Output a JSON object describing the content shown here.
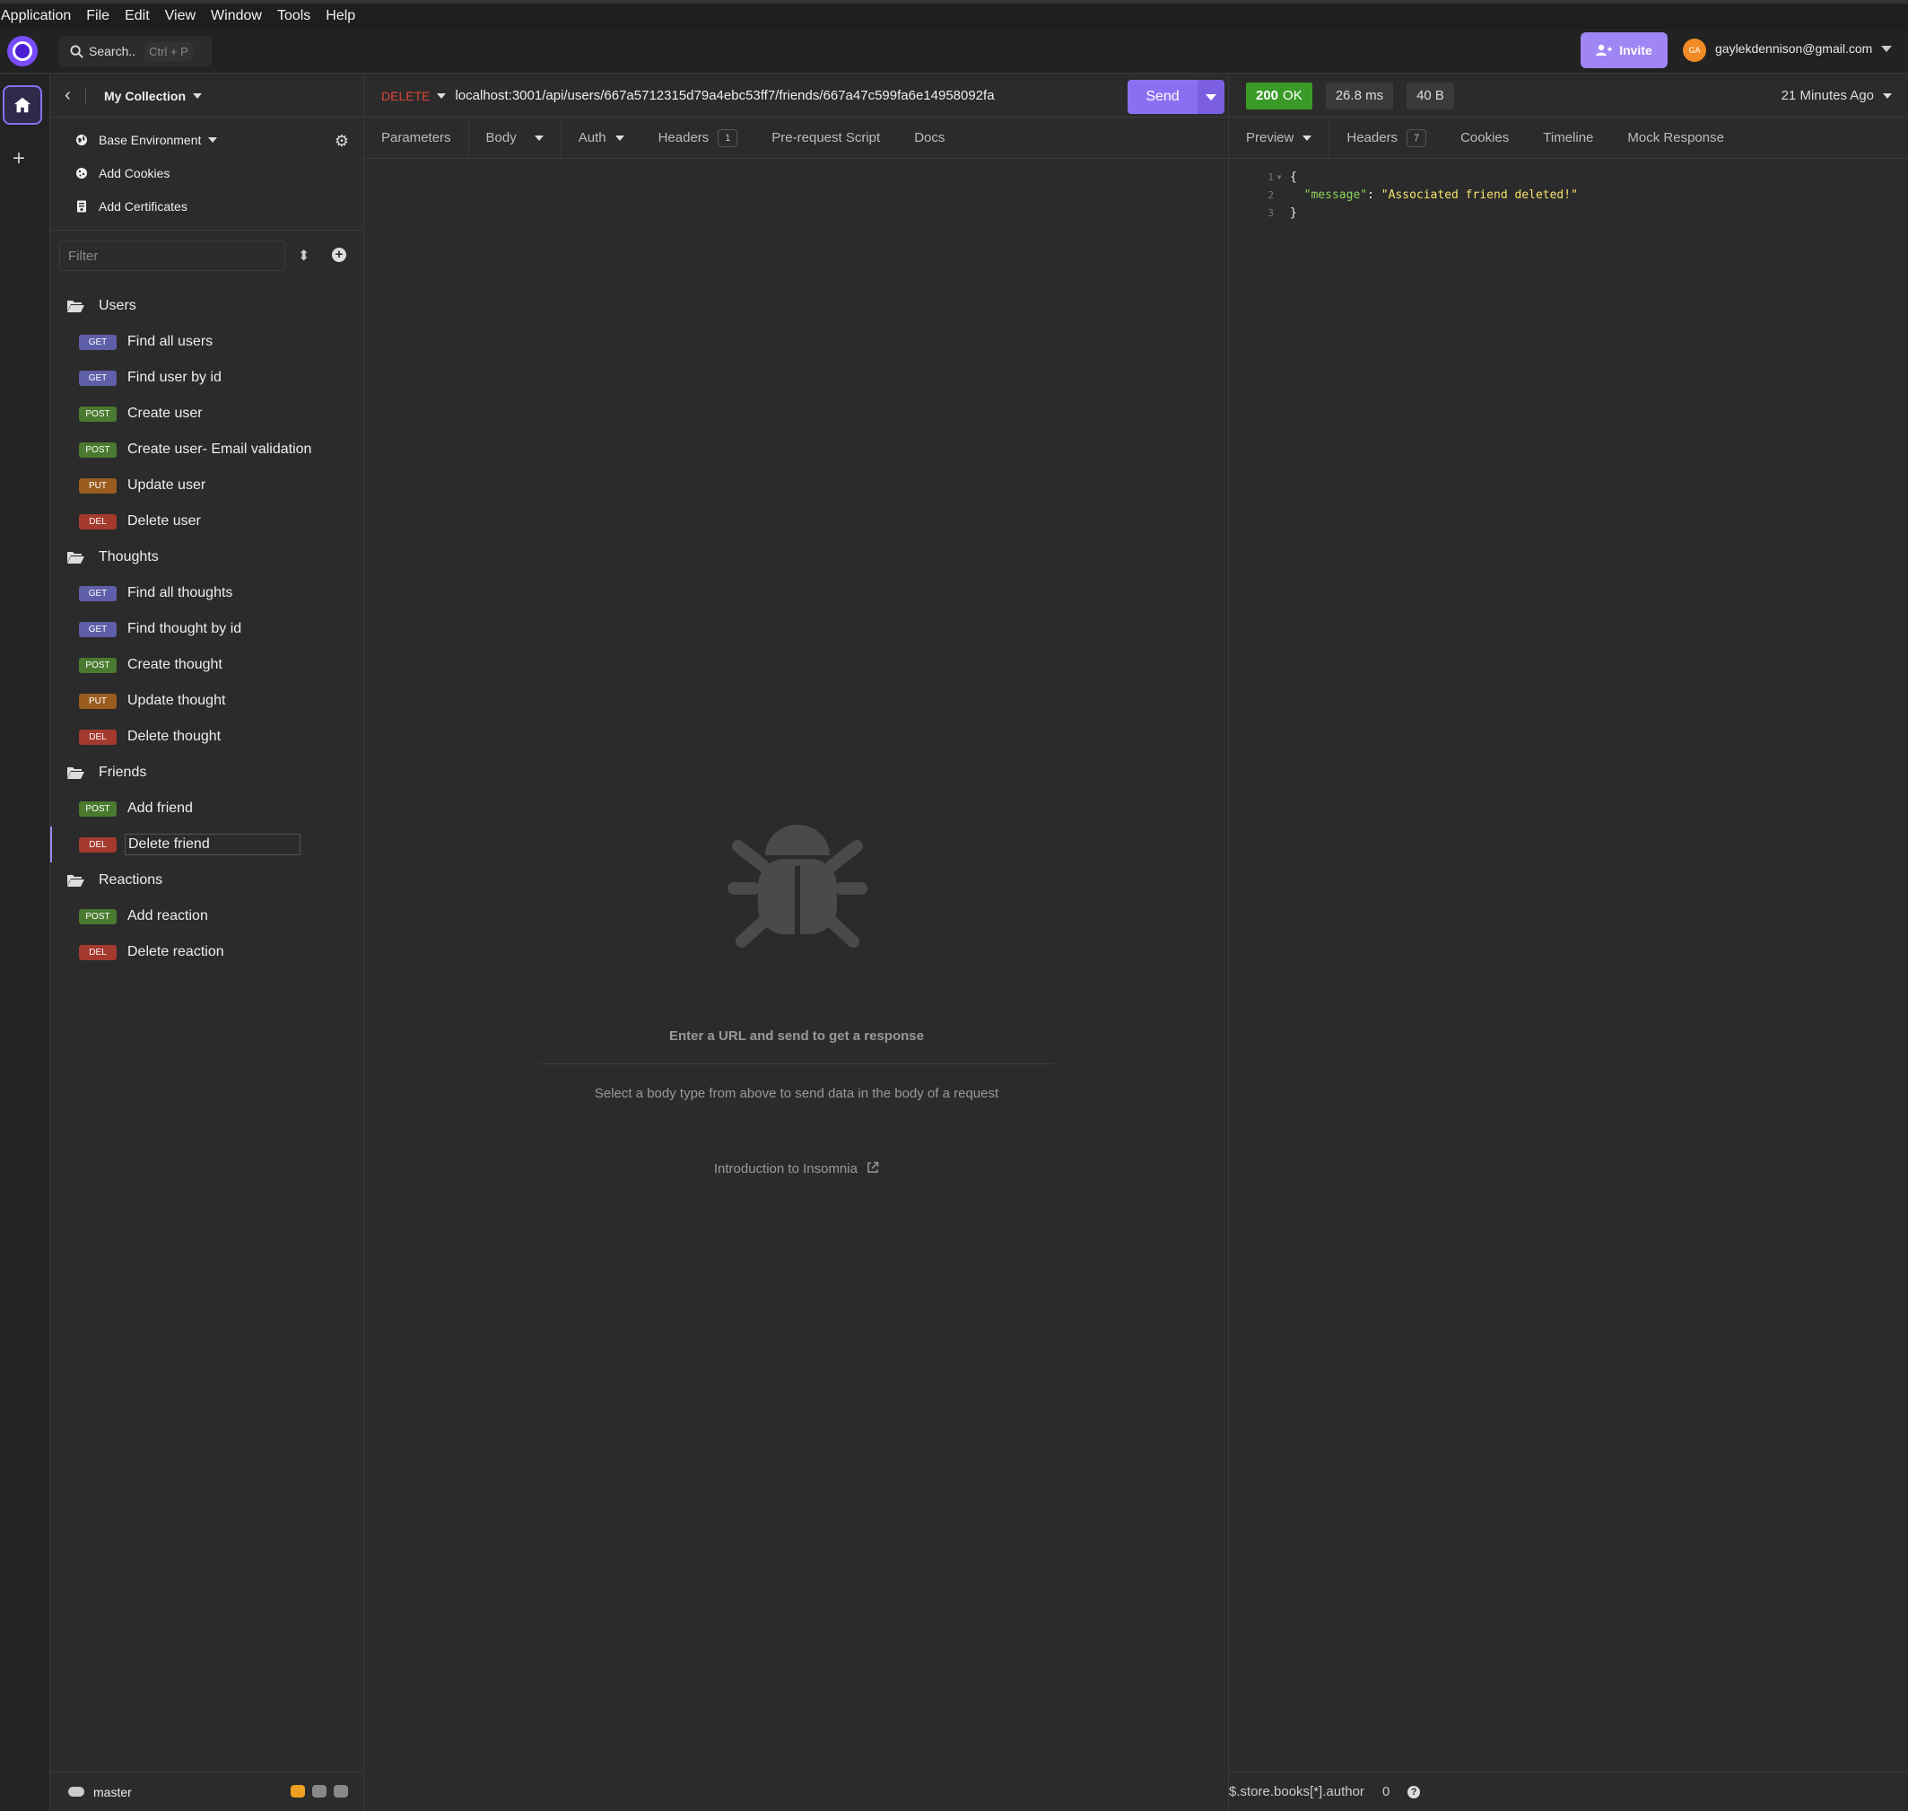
{
  "menu": [
    "Application",
    "File",
    "Edit",
    "View",
    "Window",
    "Tools",
    "Help"
  ],
  "topbar": {
    "search_label": "Search..",
    "search_shortcut": "Ctrl + P",
    "invite_label": "Invite",
    "avatar_initials": "GA",
    "user_email": "gaylekdennison@gmail.com"
  },
  "sidebar": {
    "collection": "My Collection",
    "environment": "Base Environment",
    "add_cookies": "Add Cookies",
    "add_certificates": "Add Certificates",
    "filter_placeholder": "Filter",
    "folders": [
      {
        "name": "Users",
        "requests": [
          {
            "method": "GET",
            "label": "Find all users"
          },
          {
            "method": "GET",
            "label": "Find user by id"
          },
          {
            "method": "POST",
            "label": "Create user"
          },
          {
            "method": "POST",
            "label": "Create user- Email validation"
          },
          {
            "method": "PUT",
            "label": "Update user"
          },
          {
            "method": "DEL",
            "label": "Delete user"
          }
        ]
      },
      {
        "name": "Thoughts",
        "requests": [
          {
            "method": "GET",
            "label": "Find all thoughts"
          },
          {
            "method": "GET",
            "label": "Find thought by id"
          },
          {
            "method": "POST",
            "label": "Create thought"
          },
          {
            "method": "PUT",
            "label": "Update thought"
          },
          {
            "method": "DEL",
            "label": "Delete thought"
          }
        ]
      },
      {
        "name": "Friends",
        "requests": [
          {
            "method": "POST",
            "label": "Add friend"
          },
          {
            "method": "DEL",
            "label": "Delete friend",
            "active": true
          }
        ]
      },
      {
        "name": "Reactions",
        "requests": [
          {
            "method": "POST",
            "label": "Add reaction"
          },
          {
            "method": "DEL",
            "label": "Delete reaction"
          }
        ]
      }
    ],
    "branch": "master"
  },
  "request": {
    "method": "DELETE",
    "url": "localhost:3001/api/users/667a5712315d79a4ebc53ff7/friends/667a47c599fa6e14958092fa",
    "send_label": "Send",
    "tabs": {
      "parameters": "Parameters",
      "body": "Body",
      "auth": "Auth",
      "headers": "Headers",
      "headers_count": "1",
      "pre_request": "Pre-request Script",
      "docs": "Docs"
    },
    "empty_title": "Enter a URL and send to get a response",
    "empty_subtitle": "Select a body type from above to send data in the body of a request",
    "intro_link": "Introduction to Insomnia"
  },
  "response": {
    "status_code": "200",
    "status_text": "OK",
    "time": "26.8 ms",
    "size": "40 B",
    "ago": "21 Minutes Ago",
    "tabs": {
      "preview": "Preview",
      "headers": "Headers",
      "headers_count": "7",
      "cookies": "Cookies",
      "timeline": "Timeline",
      "mock": "Mock Response"
    },
    "lines": [
      {
        "num": "1",
        "text": "{"
      },
      {
        "num": "2",
        "key": "\"message\"",
        "sep": ": ",
        "value": "\"Associated friend deleted!\""
      },
      {
        "num": "3",
        "text": "}"
      }
    ],
    "filter_expression": "$.store.books[*].author",
    "filter_count": "0"
  },
  "colors": {
    "accent": "#8b6ff3",
    "get": "#5f5ea8",
    "post": "#4a7a2f",
    "put": "#9a5d1f",
    "delete": "#a43a2e",
    "status_ok": "#3a9a27"
  }
}
